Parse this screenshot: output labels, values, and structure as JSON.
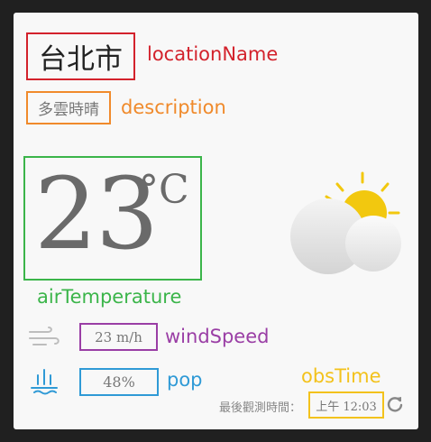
{
  "weather": {
    "locationName": "台北市",
    "description": "多雲時晴",
    "airTemperature": "23",
    "temperatureUnit": "°C",
    "windSpeed": "23 m/h",
    "pop": "48%",
    "obsTimeLabel": "最後觀測時間：",
    "obsTime": "上午 12:03",
    "icons": {
      "condition": "partly-cloudy-day-icon",
      "wind": "wind-icon",
      "pop": "rain-icon",
      "refresh": "refresh-icon"
    }
  },
  "annotations": {
    "locationName": "locationName",
    "description": "description",
    "airTemperature": "airTemperature",
    "windSpeed": "windSpeed",
    "pop": "pop",
    "obsTime": "obsTime"
  },
  "colors": {
    "locationName": "#d3222c",
    "description": "#f08a2b",
    "airTemperature": "#3bb54a",
    "windSpeed": "#9a3ea5",
    "pop": "#2f9ad6",
    "obsTime": "#f3c21c",
    "sun": "#f2c80f"
  }
}
